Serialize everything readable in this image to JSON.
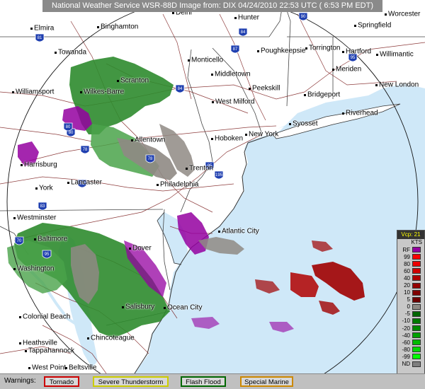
{
  "header": {
    "title": "National Weather Service WSR-88D Image  from: DIX 04/24/2010 22:53 UTC ( 6:53 PM EDT)"
  },
  "cities": [
    {
      "name": "Elmira"
    },
    {
      "name": "Binghamton"
    },
    {
      "name": "Delhi"
    },
    {
      "name": "Hunter"
    },
    {
      "name": "Springfield"
    },
    {
      "name": "Worcester"
    },
    {
      "name": "Towanda"
    },
    {
      "name": "Monticello"
    },
    {
      "name": "Poughkeepsie"
    },
    {
      "name": "Torrington"
    },
    {
      "name": "Hartford"
    },
    {
      "name": "Willimantic"
    },
    {
      "name": "Scranton"
    },
    {
      "name": "Middletown"
    },
    {
      "name": "Meriden"
    },
    {
      "name": "New London"
    },
    {
      "name": "Williamsport"
    },
    {
      "name": "Wilkes-Barre"
    },
    {
      "name": "Peekskill"
    },
    {
      "name": "Bridgeport"
    },
    {
      "name": "West Milford"
    },
    {
      "name": "Riverhead"
    },
    {
      "name": "Syosset"
    },
    {
      "name": "New York"
    },
    {
      "name": "Allentown"
    },
    {
      "name": "Hoboken"
    },
    {
      "name": "Harrisburg"
    },
    {
      "name": "Trenton"
    },
    {
      "name": "Lancaster"
    },
    {
      "name": "Philadelphia"
    },
    {
      "name": "York"
    },
    {
      "name": "Westminster"
    },
    {
      "name": "Atlantic City"
    },
    {
      "name": "Baltimore"
    },
    {
      "name": "Dover"
    },
    {
      "name": "Washington"
    },
    {
      "name": "Salisbury"
    },
    {
      "name": "Ocean City"
    },
    {
      "name": "Colonial Beach"
    },
    {
      "name": "Chincoteague"
    },
    {
      "name": "Heathsville"
    },
    {
      "name": "Tappahannock"
    },
    {
      "name": "West Point"
    },
    {
      "name": "Beltsville"
    }
  ],
  "interstates": [
    "90",
    "81",
    "84",
    "84",
    "95",
    "80",
    "76",
    "78",
    "195",
    "83",
    "70",
    "95",
    "95",
    "78",
    "80",
    "87"
  ],
  "legend": {
    "header": "Vcp: 21",
    "unit": "KTS",
    "rows": [
      {
        "label": "RF",
        "color": "#9400a0"
      },
      {
        "label": "99",
        "color": "#ff0000"
      },
      {
        "label": "80",
        "color": "#ee0000"
      },
      {
        "label": "60",
        "color": "#d00000"
      },
      {
        "label": "40",
        "color": "#b00000"
      },
      {
        "label": "20",
        "color": "#950000"
      },
      {
        "label": "10",
        "color": "#800000"
      },
      {
        "label": "5",
        "color": "#6e0000"
      },
      {
        "label": "0",
        "color": "#8f8a84"
      },
      {
        "label": "-5",
        "color": "#006600"
      },
      {
        "label": "-10",
        "color": "#007a00"
      },
      {
        "label": "-20",
        "color": "#008a00"
      },
      {
        "label": "-40",
        "color": "#00a000"
      },
      {
        "label": "-60",
        "color": "#00bb00"
      },
      {
        "label": "-80",
        "color": "#00d800"
      },
      {
        "label": "-99",
        "color": "#00ff00"
      },
      {
        "label": "ND",
        "color": "#7f7f7f"
      }
    ]
  },
  "warnings": {
    "title": "Warnings:",
    "buttons": [
      {
        "label": "Tornado",
        "border": "#cc0000"
      },
      {
        "label": "Severe Thunderstorm",
        "border": "#cccc00"
      },
      {
        "label": "Flash Flood",
        "border": "#006600"
      },
      {
        "label": "Special Marine",
        "border": "#cc8800"
      }
    ]
  },
  "colors": {
    "ocean": "#cfe8f8",
    "land": "#ffffff",
    "rf": "#9400a0",
    "outbound": "#a00000",
    "inbound": "#2e8b2e",
    "zero": "#8f8a84"
  }
}
